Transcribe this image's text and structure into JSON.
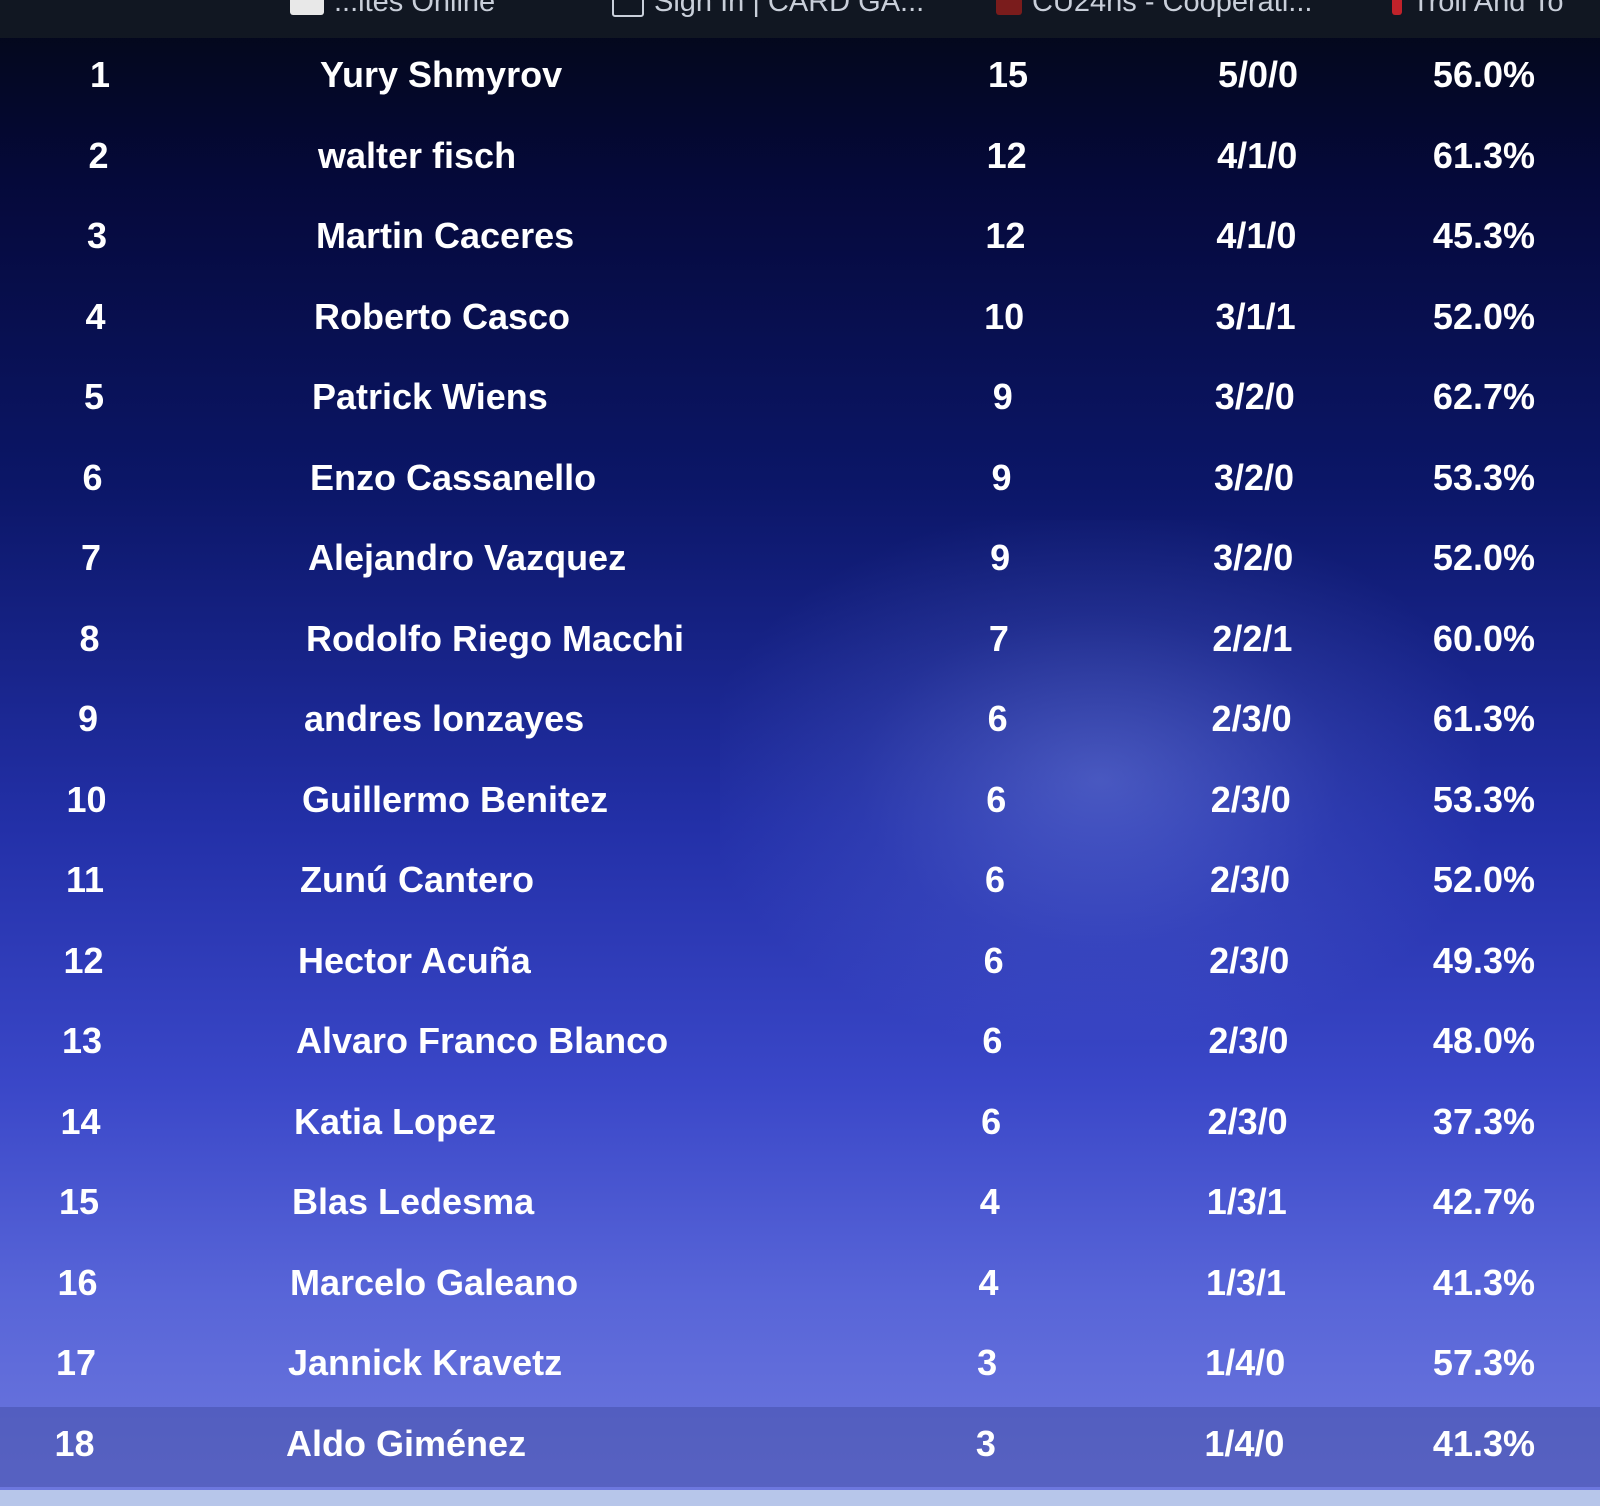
{
  "bookmarks": [
    {
      "label": "...ites Online",
      "icon": "bookmark-page-icon",
      "color": "#e8e8e8"
    },
    {
      "label": "Sign In | CARD GA...",
      "icon": "card-game-icon",
      "color": "#c9cfda"
    },
    {
      "label": "CU24hs - Cooperati...",
      "icon": "cooperative-site-icon",
      "color": "#7a1c1c"
    },
    {
      "label": "Troll And To",
      "icon": "troll-site-icon",
      "color": "#c0222a"
    }
  ],
  "standings": [
    {
      "rank": "1",
      "name": "Yury Shmyrov",
      "points": "15",
      "record": "5/0/0",
      "omw": "56.0%"
    },
    {
      "rank": "2",
      "name": "walter fisch",
      "points": "12",
      "record": "4/1/0",
      "omw": "61.3%"
    },
    {
      "rank": "3",
      "name": "Martin Caceres",
      "points": "12",
      "record": "4/1/0",
      "omw": "45.3%"
    },
    {
      "rank": "4",
      "name": "Roberto Casco",
      "points": "10",
      "record": "3/1/1",
      "omw": "52.0%"
    },
    {
      "rank": "5",
      "name": "Patrick Wiens",
      "points": "9",
      "record": "3/2/0",
      "omw": "62.7%"
    },
    {
      "rank": "6",
      "name": "Enzo Cassanello",
      "points": "9",
      "record": "3/2/0",
      "omw": "53.3%"
    },
    {
      "rank": "7",
      "name": "Alejandro Vazquez",
      "points": "9",
      "record": "3/2/0",
      "omw": "52.0%"
    },
    {
      "rank": "8",
      "name": "Rodolfo Riego Macchi",
      "points": "7",
      "record": "2/2/1",
      "omw": "60.0%"
    },
    {
      "rank": "9",
      "name": "andres lonzayes",
      "points": "6",
      "record": "2/3/0",
      "omw": "61.3%"
    },
    {
      "rank": "10",
      "name": "Guillermo Benitez",
      "points": "6",
      "record": "2/3/0",
      "omw": "53.3%"
    },
    {
      "rank": "11",
      "name": "Zunú Cantero",
      "points": "6",
      "record": "2/3/0",
      "omw": "52.0%"
    },
    {
      "rank": "12",
      "name": "Hector Acuña",
      "points": "6",
      "record": "2/3/0",
      "omw": "49.3%"
    },
    {
      "rank": "13",
      "name": "Alvaro Franco Blanco",
      "points": "6",
      "record": "2/3/0",
      "omw": "48.0%"
    },
    {
      "rank": "14",
      "name": "Katia Lopez",
      "points": "6",
      "record": "2/3/0",
      "omw": "37.3%"
    },
    {
      "rank": "15",
      "name": "Blas Ledesma",
      "points": "4",
      "record": "1/3/1",
      "omw": "42.7%"
    },
    {
      "rank": "16",
      "name": "Marcelo Galeano",
      "points": "4",
      "record": "1/3/1",
      "omw": "41.3%"
    },
    {
      "rank": "17",
      "name": "Jannick Kravetz",
      "points": "3",
      "record": "1/4/0",
      "omw": "57.3%"
    },
    {
      "rank": "18",
      "name": "Aldo Giménez",
      "points": "3",
      "record": "1/4/0",
      "omw": "41.3%"
    }
  ]
}
